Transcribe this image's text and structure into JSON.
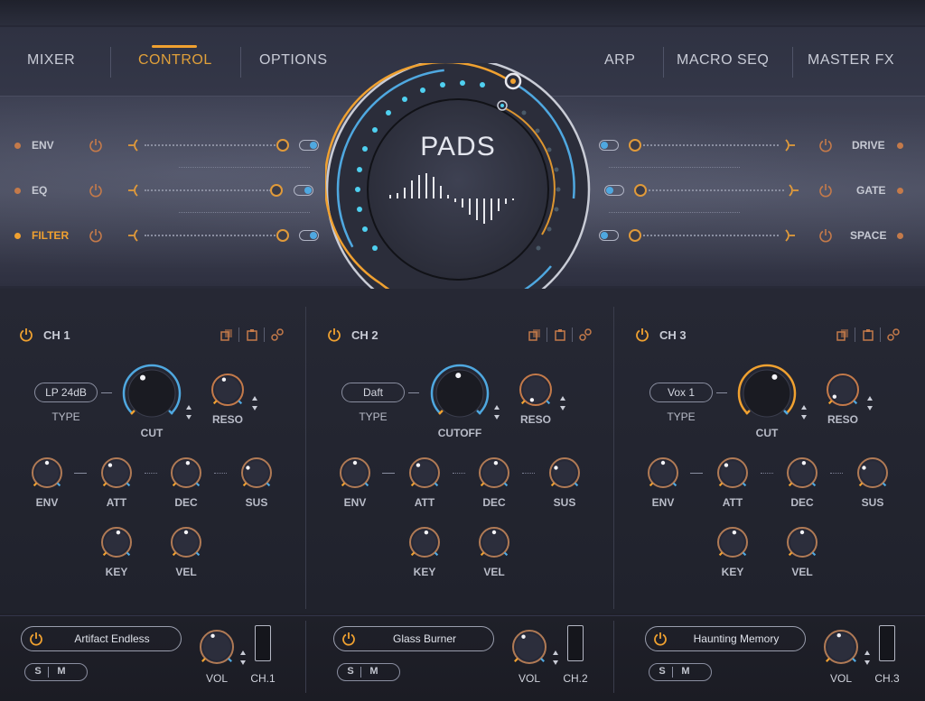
{
  "colors": {
    "accent": "#f0a130",
    "blue": "#4fa8e0",
    "muted": "#8a8ea0"
  },
  "nav": {
    "left": [
      {
        "label": "MIXER"
      },
      {
        "label": "CONTROL",
        "active": true
      },
      {
        "label": "OPTIONS"
      }
    ],
    "right": [
      {
        "label": "ARP"
      },
      {
        "label": "MACRO SEQ"
      },
      {
        "label": "MASTER FX"
      }
    ]
  },
  "center": {
    "title": "PADS"
  },
  "fx_left": [
    {
      "label": "ENV",
      "enabled": false
    },
    {
      "label": "EQ",
      "enabled": false
    },
    {
      "label": "FILTER",
      "enabled": true
    }
  ],
  "fx_right": [
    {
      "label": "DRIVE"
    },
    {
      "label": "GATE"
    },
    {
      "label": "SPACE"
    }
  ],
  "channels": [
    {
      "title": "CH 1",
      "type_value": "LP 24dB",
      "type_label": "TYPE",
      "cutoff_label": "CUT",
      "reso_label": "RESO",
      "env_knobs": [
        "ENV",
        "ATT",
        "DEC",
        "SUS"
      ],
      "mod_knobs": [
        "KEY",
        "VEL"
      ],
      "preset": "Artifact Endless",
      "solo": "S",
      "mute": "M",
      "vol_label": "VOL",
      "ch_label": "CH.1"
    },
    {
      "title": "CH 2",
      "type_value": "Daft",
      "type_label": "TYPE",
      "cutoff_label": "CUTOFF",
      "reso_label": "RESO",
      "env_knobs": [
        "ENV",
        "ATT",
        "DEC",
        "SUS"
      ],
      "mod_knobs": [
        "KEY",
        "VEL"
      ],
      "preset": "Glass Burner",
      "solo": "S",
      "mute": "M",
      "vol_label": "VOL",
      "ch_label": "CH.2"
    },
    {
      "title": "CH 3",
      "type_value": "Vox 1",
      "type_label": "TYPE",
      "cutoff_label": "CUT",
      "reso_label": "RESO",
      "env_knobs": [
        "ENV",
        "ATT",
        "DEC",
        "SUS"
      ],
      "mod_knobs": [
        "KEY",
        "VEL"
      ],
      "preset": "Haunting Memory",
      "solo": "S",
      "mute": "M",
      "vol_label": "VOL",
      "ch_label": "CH.3"
    }
  ],
  "icons": [
    "power-icon",
    "copy-icon",
    "paste-icon",
    "link-icon",
    "up-down-arrows-icon"
  ]
}
